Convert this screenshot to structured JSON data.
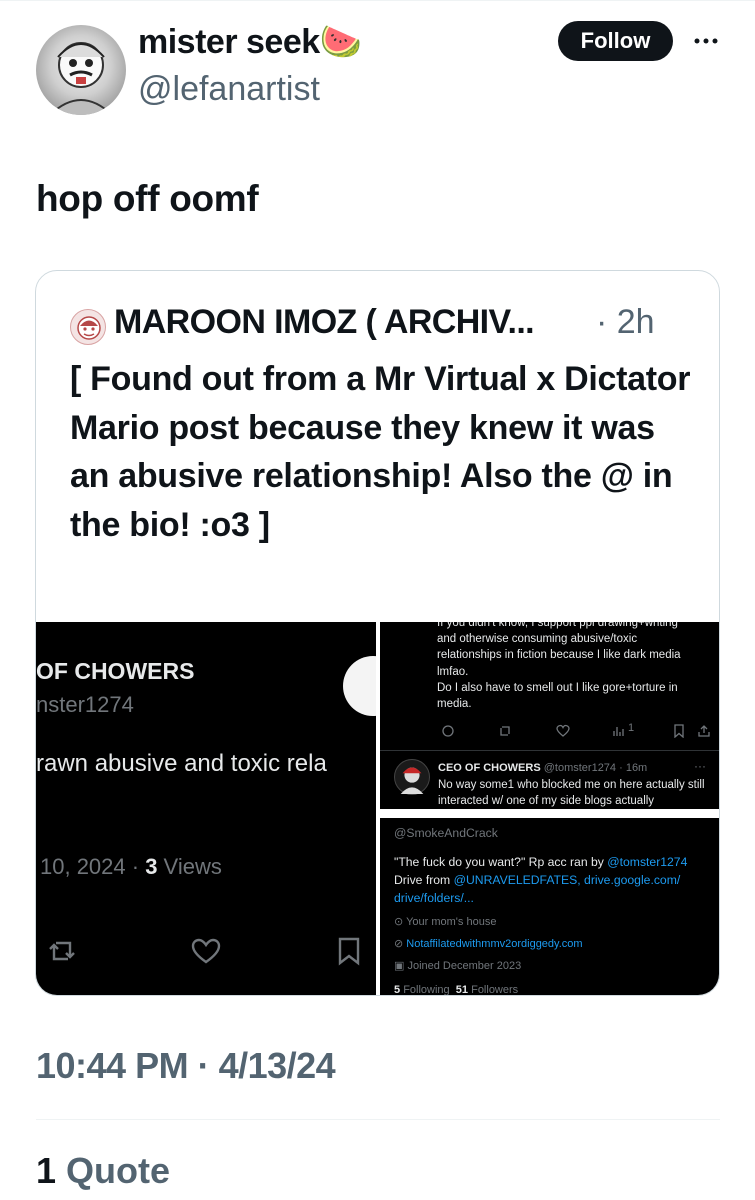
{
  "author": {
    "display_name": "mister seek🍉",
    "handle": "@lefanartist"
  },
  "header": {
    "follow_label": "Follow",
    "more_label": "···"
  },
  "tweet": {
    "text": "hop off oomf",
    "timestamp": "10:44 PM · 4/13/24",
    "quote_count": "1",
    "quote_label": "Quote"
  },
  "quoted": {
    "display_name": "MAROON IMOZ ( ARCHIV...",
    "time": "· 2h",
    "text": "[ Found out from a Mr Virtual x Dictator Mario post because they knew it was an abusive relationship! Also the @ in the bio! :o3 ]"
  },
  "image_left": {
    "name": "OF CHOWERS",
    "handle": "nster1274",
    "bio": "rawn abusive and toxic rela",
    "date": "10, 2024 · ",
    "views_count": "3",
    "views_label": " Views"
  },
  "image_right_top": {
    "text_lines": [
      "If you didn't know, I support ppl drawing+writing",
      "and otherwise consuming abusive/toxic",
      "relationships in fiction because I like dark media",
      "lmfao.",
      "Do I also have to smell out I like gore+torture in",
      "media."
    ],
    "views": "1",
    "reply_name": "CEO OF CHOWERS",
    "reply_meta": "@tomster1274 · 16m",
    "reply_text": "No way some1 who blocked me on here actually still interacted w/ one of my side blogs actually"
  },
  "image_right_bottom": {
    "handle": "@SmokeAndCrack",
    "bio_prefix": "\"The fuck do you want?\" Rp acc ran by ",
    "bio_link1": "@tomster1274",
    "bio_line2_prefix": "Drive from ",
    "bio_link2": "@UNRAVELEDFATES",
    "bio_link3": ", drive.google.com/",
    "bio_link4": "drive/folders/...",
    "location": "Your mom's house",
    "website": "Notaffilatedwithmmv2ordiggedy.com",
    "joined": "Joined December 2023",
    "following_count": "5",
    "following_label": "Following",
    "followers_count": "51",
    "followers_label": "Followers"
  },
  "colors": {
    "text": "#0f1419",
    "muted": "#536471",
    "link": "#1d9bf0",
    "border": "#cfd9de"
  }
}
